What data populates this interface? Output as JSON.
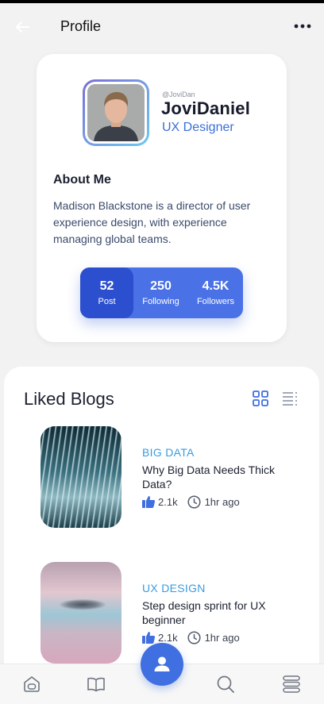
{
  "header": {
    "title": "Profile",
    "back_icon": "arrow-left-icon",
    "more_icon": "more-horizontal-icon"
  },
  "profile": {
    "handle": "@JoviDan",
    "name": "JoviDaniel",
    "role": "UX Designer",
    "about_title": "About Me",
    "about_text": "Madison Blackstone is a director of user experience design, with experience managing global teams."
  },
  "stats": [
    {
      "value": "52",
      "label": "Post"
    },
    {
      "value": "250",
      "label": "Following"
    },
    {
      "value": "4.5K",
      "label": "Followers"
    }
  ],
  "liked_blogs": {
    "title": "Liked Blogs",
    "items": [
      {
        "category": "BIG DATA",
        "title": "Why Big Data Needs Thick Data?",
        "likes": "2.1k",
        "time": "1hr ago"
      },
      {
        "category": "UX DESIGN",
        "title": "Step design sprint for UX beginner",
        "likes": "2.1k",
        "time": "1hr ago"
      }
    ]
  },
  "bottom_nav": [
    "home-icon",
    "book-icon",
    "profile-icon",
    "search-icon",
    "menu-icon"
  ],
  "colors": {
    "accent": "#3f6fe0",
    "category": "#3a9be0",
    "stats_bg": "#4a72e6",
    "stats_active": "#2c4fcf"
  }
}
